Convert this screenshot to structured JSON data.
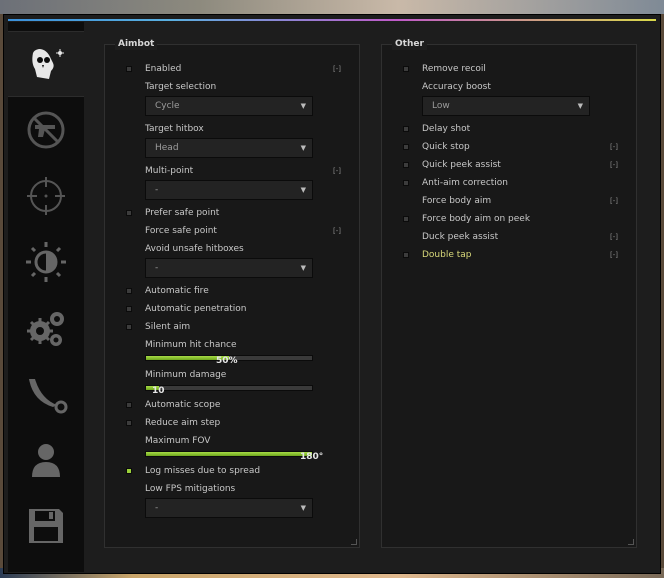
{
  "tabs": [
    {
      "icon": "skull-target-icon",
      "active": true
    },
    {
      "icon": "no-gun-icon",
      "active": false
    },
    {
      "icon": "crosshair-icon",
      "active": false
    },
    {
      "icon": "brightness-icon",
      "active": false
    },
    {
      "icon": "gears-icon",
      "active": false
    },
    {
      "icon": "karambit-knife-icon",
      "active": false
    },
    {
      "icon": "person-icon",
      "active": false
    },
    {
      "icon": "floppy-save-icon",
      "active": false
    }
  ],
  "aimbot": {
    "title": "Aimbot",
    "enabled": {
      "label": "Enabled",
      "checked": false,
      "key": "[-]"
    },
    "target_selection": {
      "label": "Target selection",
      "value": "Cycle"
    },
    "target_hitbox": {
      "label": "Target hitbox",
      "value": "Head"
    },
    "multi_point": {
      "label": "Multi-point",
      "value": "-",
      "key": "[-]"
    },
    "prefer_safe_point": {
      "label": "Prefer safe point",
      "checked": false
    },
    "force_safe_point": {
      "label": "Force safe point",
      "key": "[-]"
    },
    "avoid_unsafe_hitboxes": {
      "label": "Avoid unsafe hitboxes",
      "value": "-"
    },
    "automatic_fire": {
      "label": "Automatic fire",
      "checked": false
    },
    "automatic_penetration": {
      "label": "Automatic penetration",
      "checked": false
    },
    "silent_aim": {
      "label": "Silent aim",
      "checked": false
    },
    "min_hit_chance": {
      "label": "Minimum hit chance",
      "value": "50%",
      "fraction": 0.5
    },
    "min_damage": {
      "label": "Minimum damage",
      "value": "10",
      "fraction": 0.08
    },
    "automatic_scope": {
      "label": "Automatic scope",
      "checked": false
    },
    "reduce_aim_step": {
      "label": "Reduce aim step",
      "checked": false
    },
    "max_fov": {
      "label": "Maximum FOV",
      "value": "180°",
      "fraction": 1.0
    },
    "log_misses": {
      "label": "Log misses due to spread",
      "checked": true
    },
    "low_fps": {
      "label": "Low FPS mitigations",
      "value": "-"
    }
  },
  "other": {
    "title": "Other",
    "remove_recoil": {
      "label": "Remove recoil",
      "checked": false
    },
    "accuracy_boost": {
      "label": "Accuracy boost",
      "value": "Low"
    },
    "delay_shot": {
      "label": "Delay shot",
      "checked": false
    },
    "quick_stop": {
      "label": "Quick stop",
      "checked": false,
      "key": "[-]"
    },
    "quick_peek_assist": {
      "label": "Quick peek assist",
      "checked": false,
      "key": "[-]"
    },
    "anti_aim_correction": {
      "label": "Anti-aim correction",
      "checked": false
    },
    "force_body_aim": {
      "label": "Force body aim",
      "key": "[-]"
    },
    "force_body_aim_on_peek": {
      "label": "Force body aim on peek",
      "checked": false
    },
    "duck_peek_assist": {
      "label": "Duck peek assist",
      "key": "[-]"
    },
    "double_tap": {
      "label": "Double tap",
      "checked": false,
      "key": "[-]"
    }
  },
  "colors": {
    "accent": "#9bd13a",
    "highlight_label": "#d8d87a",
    "background": "#1d1d1d"
  },
  "dropdown_arrow": "▼"
}
